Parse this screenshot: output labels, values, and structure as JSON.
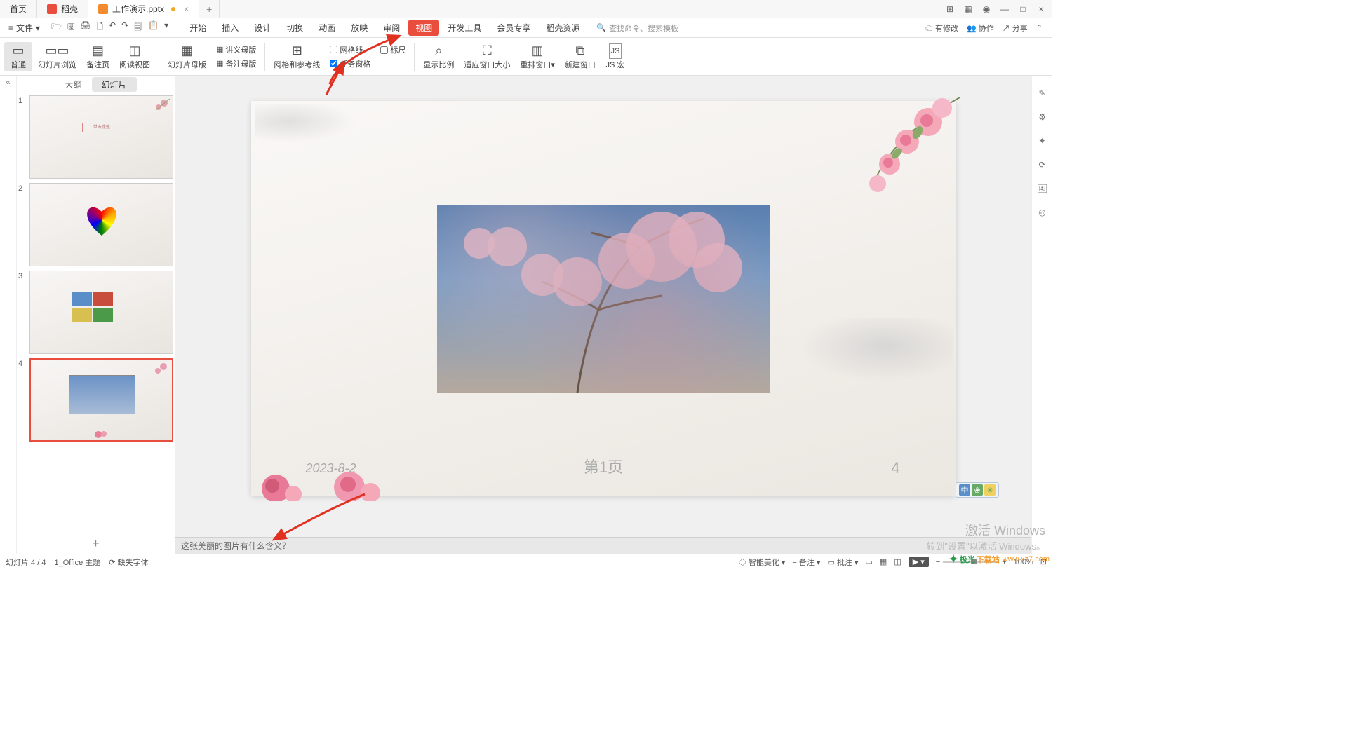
{
  "titlebar": {
    "tabs": [
      {
        "label": "首页"
      },
      {
        "label": "稻壳"
      },
      {
        "label": "工作演示.pptx",
        "modified": true
      }
    ],
    "plus": "+"
  },
  "menubar": {
    "file": "文件",
    "tabs": [
      "开始",
      "插入",
      "设计",
      "切换",
      "动画",
      "放映",
      "审阅",
      "视图",
      "开发工具",
      "会员专享",
      "稻壳资源"
    ],
    "active_tab": "视图",
    "search_placeholder": "查找命令、搜索模板",
    "right": {
      "pending": "有修改",
      "collab": "协作",
      "share": "分享"
    }
  },
  "ribbon": {
    "items": [
      {
        "label": "普通",
        "icon": "▭",
        "active": true
      },
      {
        "label": "幻灯片浏览",
        "icon": "▭▭"
      },
      {
        "label": "备注页",
        "icon": "▤"
      },
      {
        "label": "阅读视图",
        "icon": "◫"
      }
    ],
    "sep1": true,
    "items2": [
      {
        "label": "幻灯片母版",
        "icon": "▦"
      }
    ],
    "masters": [
      {
        "label": "讲义母版"
      },
      {
        "label": "备注母版"
      }
    ],
    "items3": [
      {
        "label": "网格和参考线",
        "icon": "⊞"
      }
    ],
    "checks": [
      {
        "label": "网格线",
        "checked": false
      },
      {
        "label": "任务窗格",
        "checked": true
      }
    ],
    "ruler": {
      "label": "标尺",
      "checked": false
    },
    "items4": [
      {
        "label": "显示比例",
        "icon": "⌕"
      },
      {
        "label": "适应窗口大小",
        "icon": "⛶"
      },
      {
        "label": "重排窗口",
        "icon": "▥"
      },
      {
        "label": "新建窗口",
        "icon": "⧉"
      },
      {
        "label": "JS 宏",
        "icon": "JS"
      }
    ]
  },
  "thumb_panel": {
    "tabs": [
      "大纲",
      "幻灯片"
    ],
    "active": "幻灯片",
    "slides": [
      "1",
      "2",
      "3",
      "4"
    ],
    "selected": 4
  },
  "slide": {
    "date": "2023-8-2",
    "page_label": "第1页",
    "page_num": "4"
  },
  "notes": {
    "text": "这张美丽的图片有什么含义？"
  },
  "status": {
    "slide_info": "幻灯片 4 / 4",
    "theme": "1_Office 主题",
    "missing_font": "缺失字体",
    "beautify": "智能美化",
    "notes": "备注",
    "comments": "批注",
    "zoom": "100%"
  },
  "watermark": {
    "line1": "激活 Windows",
    "line2": "转到\"设置\"以激活 Windows。"
  },
  "logo": {
    "t1": "极光",
    "t2": "下载站",
    "url": "www.xz7.com"
  }
}
